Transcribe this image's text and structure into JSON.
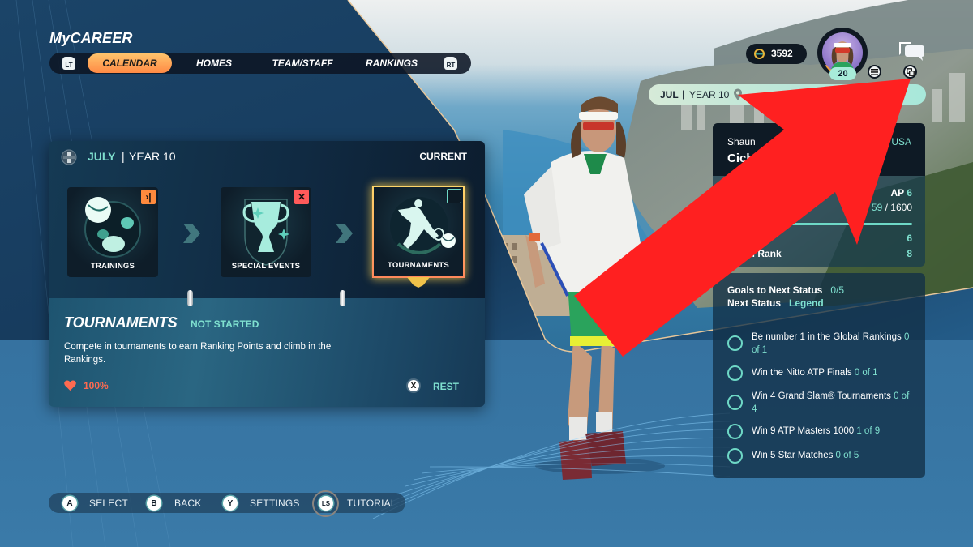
{
  "header": {
    "title": "MyCAREER",
    "left_trigger": "LT",
    "right_trigger": "RT",
    "tabs": [
      {
        "label": "CALENDAR",
        "active": true
      },
      {
        "label": "HOMES",
        "active": false
      },
      {
        "label": "TEAM/STAFF",
        "active": false
      },
      {
        "label": "RANKINGS",
        "active": false
      }
    ]
  },
  "calendar": {
    "month": "JULY",
    "separator": "|",
    "year": "YEAR 10",
    "status": "CURRENT",
    "cards": [
      {
        "label": "TRAININGS",
        "badge": "skip",
        "badge_glyph": "›|",
        "badge_color": "#ff8a3d"
      },
      {
        "label": "SPECIAL EVENTS",
        "badge": "unavailable",
        "badge_glyph": "✕",
        "badge_color": "#ff5a5a"
      },
      {
        "label": "TOURNAMENTS",
        "badge": "empty",
        "badge_glyph": "",
        "selected": true
      }
    ],
    "detail": {
      "title": "TOURNAMENTS",
      "status": "NOT STARTED",
      "description": "Compete in tournaments to earn Ranking Points and climb in the Rankings.",
      "energy": "100%",
      "rest_button": "X",
      "rest_label": "REST"
    }
  },
  "hints": [
    {
      "button": "A",
      "label": "SELECT"
    },
    {
      "button": "B",
      "label": "BACK"
    },
    {
      "button": "Y",
      "label": "SETTINGS"
    },
    {
      "button": "LS",
      "label": "TUTORIAL"
    }
  ],
  "hud": {
    "coins": "3592",
    "level": "20",
    "location_bar": {
      "month": "JUL",
      "separator": "|",
      "year": "YEAR 10"
    }
  },
  "player": {
    "first_name": "Shaun",
    "last_name_visible": "Cich",
    "country": "USA",
    "ap_label": "AP",
    "ap_value": "6",
    "points_visible": "59",
    "points_max": "/ 1600",
    "rank_rows": [
      {
        "label_visible": "nk",
        "value": "6"
      },
      {
        "label_visible": "al Rank",
        "value": "8"
      }
    ],
    "goals_label": "Goals to Next Status",
    "goals_value": "0/5",
    "next_status_label": "Next Status",
    "next_status_value": "Legend",
    "goals": [
      {
        "text": "Be number 1 in the Global Rankings",
        "progress": "0 of 1"
      },
      {
        "text": "Win the Nitto ATP Finals",
        "progress": "0 of 1"
      },
      {
        "text": "Win 4 Grand Slam® Tournaments",
        "progress": "0 of 4"
      },
      {
        "text": "Win 9 ATP Masters 1000",
        "progress": "1 of 9"
      },
      {
        "text": "Win 5 Star Matches",
        "progress": "0 of 5"
      }
    ]
  },
  "colors": {
    "accent_teal": "#7fe0cf",
    "tab_active": "#ffa95a",
    "energy": "#ff6a50",
    "overlay_arrow": "#ff2020"
  }
}
